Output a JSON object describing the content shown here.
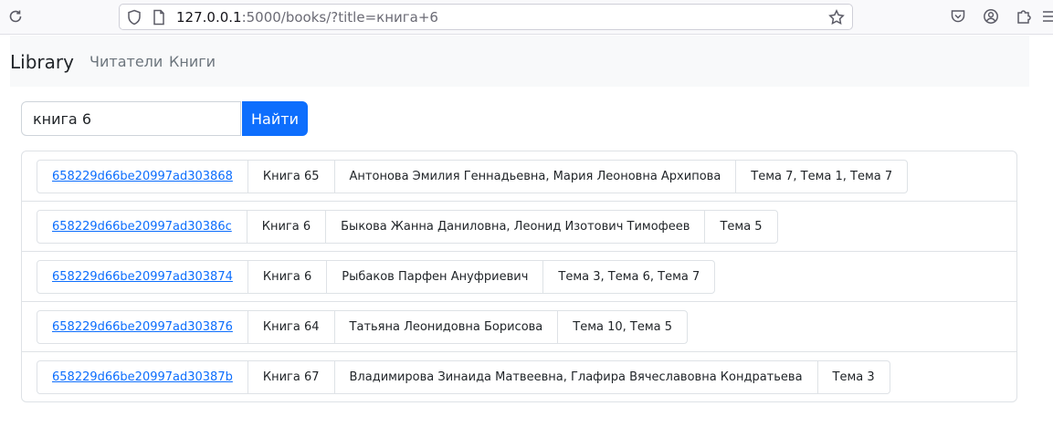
{
  "browser": {
    "url_host": "127.0.0.1",
    "url_rest": ":5000/books/?title=книга+6"
  },
  "navbar": {
    "brand": "Library",
    "links": [
      "Читатели",
      "Книги"
    ]
  },
  "search": {
    "value": "книга 6",
    "button_label": "Найти"
  },
  "books": [
    {
      "id": "658229d66be20997ad303868",
      "title": "Книга 65",
      "authors": "Антонова Эмилия Геннадьевна, Мария Леоновна Архипова",
      "topics": "Тема 7, Тема 1, Тема 7"
    },
    {
      "id": "658229d66be20997ad30386c",
      "title": "Книга 6",
      "authors": "Быкова Жанна Даниловна, Леонид Изотович Тимофеев",
      "topics": "Тема 5"
    },
    {
      "id": "658229d66be20997ad303874",
      "title": "Книга 6",
      "authors": "Рыбаков Парфен Ануфриевич",
      "topics": "Тема 3, Тема 6, Тема 7"
    },
    {
      "id": "658229d66be20997ad303876",
      "title": "Книга 64",
      "authors": "Татьяна Леонидовна Борисова",
      "topics": "Тема 10, Тема 5"
    },
    {
      "id": "658229d66be20997ad30387b",
      "title": "Книга 67",
      "authors": "Владимирова Зинаида Матвеевна, Глафира Вячеславовна Кондратьева",
      "topics": "Тема 3"
    }
  ]
}
